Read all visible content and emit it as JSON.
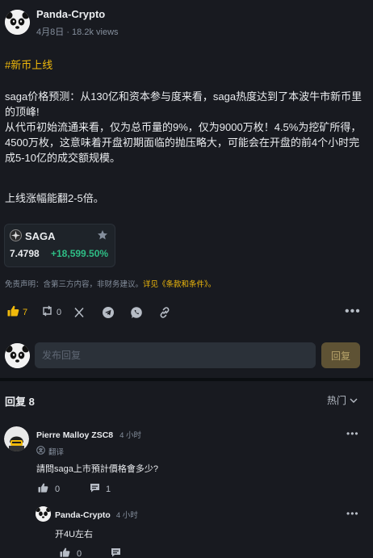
{
  "post": {
    "author": "Panda-Crypto",
    "date": "4月8日",
    "views": "18.2k views",
    "tag": "#新币上线",
    "paragraphs": [
      "saga价格预测：从130亿和资本参与度来看，saga热度达到了本波牛市新币里",
      "的顶峰!",
      "从代币初始流通来看，仅为总币量的9%，仅为9000万枚！4.5%为挖矿所得，",
      "4500万枚，这意味着开盘初期面临的抛压略大，可能会在开盘的前4个小时完",
      "成5-10亿的成交额规模。",
      "上线涨幅能翻2-5倍。"
    ]
  },
  "coin_card": {
    "symbol": "SAGA",
    "price": "7.4798",
    "change": "+18,599.50%",
    "change_color": "#2ebd85"
  },
  "disclaimer": {
    "text": "免责声明：含第三方内容，非财务建议。",
    "link": "详见《条款和条件》。"
  },
  "actions": {
    "like_count": "7",
    "repost_count": "0"
  },
  "comment_box": {
    "placeholder": "发布回复",
    "button": "回复"
  },
  "replies": {
    "title": "回复 8",
    "sort_label": "热门"
  },
  "comments": [
    {
      "author": "Pierre Malloy ZSC8",
      "time": "4 小时",
      "translate": "翻译",
      "text": "請問saga上市預計價格會多少?",
      "likes": "0",
      "replies": "1"
    },
    {
      "author": "Panda-Crypto",
      "time": "4 小时",
      "text": "开4U左右",
      "likes": "0"
    }
  ],
  "colors": {
    "background": "#181a20",
    "accent": "#f0b90b",
    "positive": "#2ebd85"
  }
}
